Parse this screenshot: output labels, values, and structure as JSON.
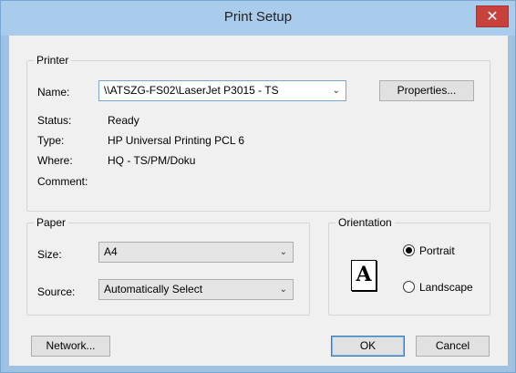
{
  "window": {
    "title": "Print Setup",
    "close_glyph": "✕"
  },
  "printer": {
    "group_label": "Printer",
    "name_label": "Name:",
    "name_value": "\\\\ATSZG-FS02\\LaserJet P3015 - TS",
    "properties_button": "Properties...",
    "status_label": "Status:",
    "status_value": "Ready",
    "type_label": "Type:",
    "type_value": "HP Universal Printing PCL 6",
    "where_label": "Where:",
    "where_value": "HQ - TS/PM/Doku",
    "comment_label": "Comment:",
    "comment_value": ""
  },
  "paper": {
    "group_label": "Paper",
    "size_label": "Size:",
    "size_value": "A4",
    "source_label": "Source:",
    "source_value": "Automatically Select"
  },
  "orientation": {
    "group_label": "Orientation",
    "icon_letter": "A",
    "portrait_label": "Portrait",
    "landscape_label": "Landscape",
    "selected": "Portrait"
  },
  "buttons": {
    "network": "Network...",
    "ok": "OK",
    "cancel": "Cancel"
  },
  "icons": {
    "dropdown": "chevron-down-icon",
    "close": "close-icon",
    "orientation": "portrait-page-icon"
  },
  "colors": {
    "title_bar": "#a9cbec",
    "close_button": "#c7423d",
    "dialog_background": "#f0f0f0",
    "focus_border": "#7aa6d2"
  }
}
